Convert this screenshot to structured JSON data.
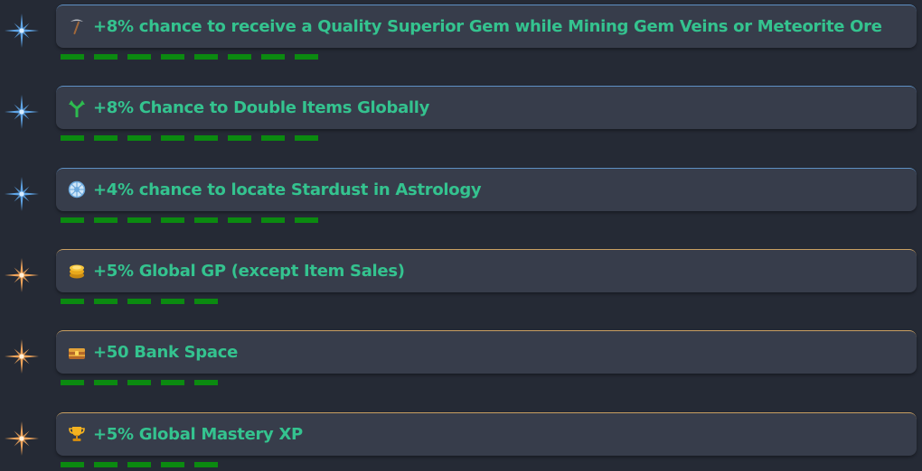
{
  "rows": [
    {
      "text": "+8% chance to receive a Quality Superior Gem while Mining Gem Veins or Meteorite Ore",
      "icon": "pickaxe-icon",
      "star": "blue-star-icon",
      "tier": "blue",
      "progress": 8
    },
    {
      "text": "+8% Chance to Double Items Globally",
      "icon": "double-arrow-icon",
      "star": "blue-star-icon",
      "tier": "blue",
      "progress": 8
    },
    {
      "text": "+4% chance to locate Stardust in Astrology",
      "icon": "stardust-wheel-icon",
      "star": "blue-star-icon",
      "tier": "blue",
      "progress": 8
    },
    {
      "text": "+5% Global GP (except Item Sales)",
      "icon": "gold-coins-icon",
      "star": "gold-star-icon",
      "tier": "gold",
      "progress": 5
    },
    {
      "text": "+50 Bank Space",
      "icon": "treasure-chest-icon",
      "star": "gold-star-icon",
      "tier": "gold",
      "progress": 5
    },
    {
      "text": "+5% Global Mastery XP",
      "icon": "trophy-icon",
      "star": "gold-star-icon",
      "tier": "gold",
      "progress": 5
    }
  ],
  "colors": {
    "background": "#252a35",
    "card": "#373d4b",
    "text": "#34c38f",
    "progress": "#0b8a10",
    "blue_accent": "#5e90c4",
    "gold_accent": "#c9a062"
  }
}
